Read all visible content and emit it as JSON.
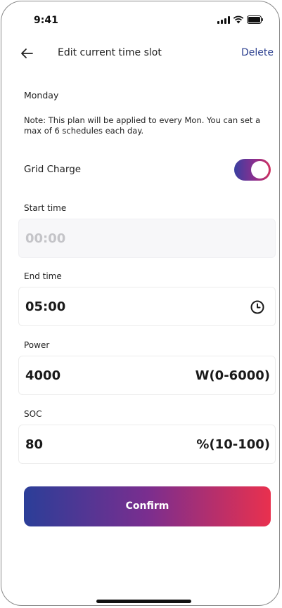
{
  "status_bar": {
    "time": "9:41",
    "icons": [
      "signal-icon",
      "wifi-icon",
      "battery-icon"
    ]
  },
  "nav": {
    "back_icon": "arrow-left-icon",
    "title": "Edit current time slot",
    "delete_label": "Delete"
  },
  "day": "Monday",
  "note": "Note: This plan will be applied to every Mon. You can set a max of 6 schedules each day.",
  "grid_charge": {
    "label": "Grid Charge",
    "enabled": true
  },
  "start_time": {
    "label": "Start time",
    "value": "00:00",
    "disabled": true
  },
  "end_time": {
    "label": "End time",
    "value": "05:00",
    "icon": "clock-icon"
  },
  "power": {
    "label": "Power",
    "value": "4000",
    "unit": "W(0-6000)"
  },
  "soc": {
    "label": "SOC",
    "value": "80",
    "unit": "%(10-100)"
  },
  "confirm_label": "Confirm",
  "colors": {
    "accent": "#2b3f8f",
    "gradient_start": "#2b3e98",
    "gradient_mid": "#7a2e8f",
    "gradient_end": "#e9304e"
  }
}
